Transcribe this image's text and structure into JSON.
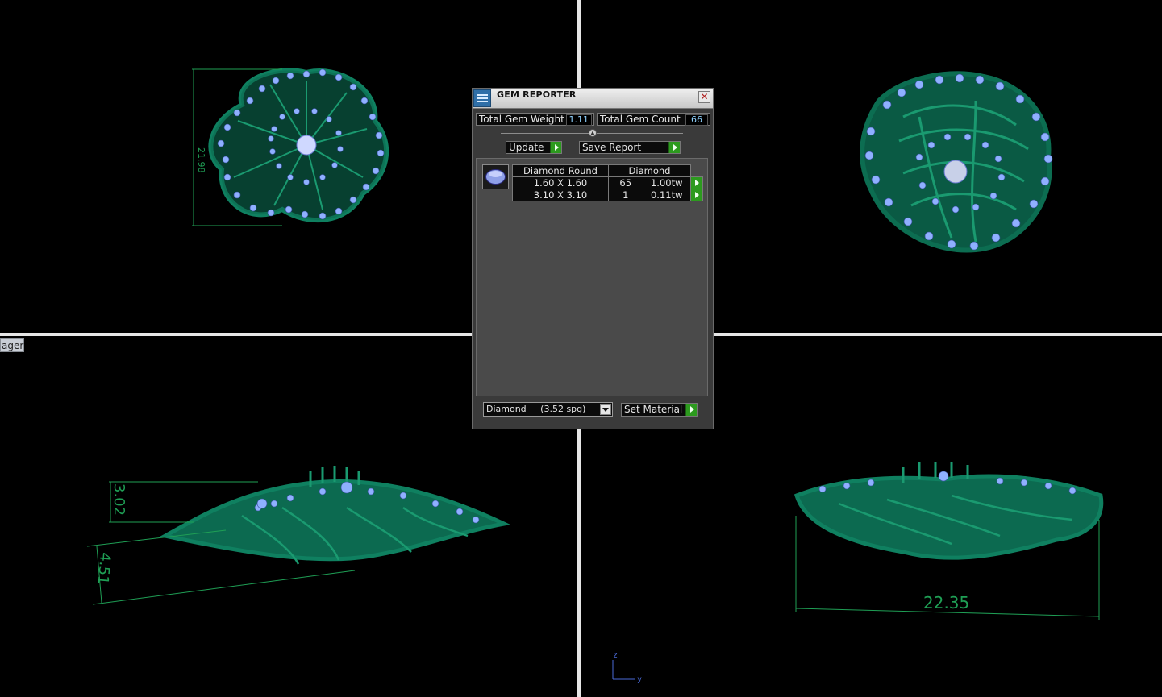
{
  "viewports": {
    "manager_tab_label": "ager",
    "dimensions": {
      "top_left_height": "21.98",
      "bottom_left_a": "3.02",
      "bottom_left_b": "4.51",
      "bottom_right_width": "22.35"
    },
    "axis": {
      "z": "z",
      "y": "y"
    }
  },
  "dialog": {
    "title": "GEM REPORTER",
    "close_glyph": "✕",
    "total_weight_label": "Total Gem Weight",
    "total_weight_value": "1.11",
    "total_count_label": "Total Gem Count",
    "total_count_value": "66",
    "update_label": "Update",
    "save_report_label": "Save Report",
    "table": {
      "header_shape": "Diamond Round",
      "header_material": "Diamond",
      "rows": [
        {
          "size": "1.60 X 1.60",
          "count": "65",
          "weight": "1.00tw"
        },
        {
          "size": "3.10 X 3.10",
          "count": "1",
          "weight": "0.11tw"
        }
      ]
    },
    "material_select": {
      "name": "Diamond",
      "density": "(3.52 spg)"
    },
    "set_material_label": "Set Material"
  },
  "colors": {
    "model": "#0f8060",
    "gem": "#8fb0ff",
    "dim": "#1f9f55"
  }
}
